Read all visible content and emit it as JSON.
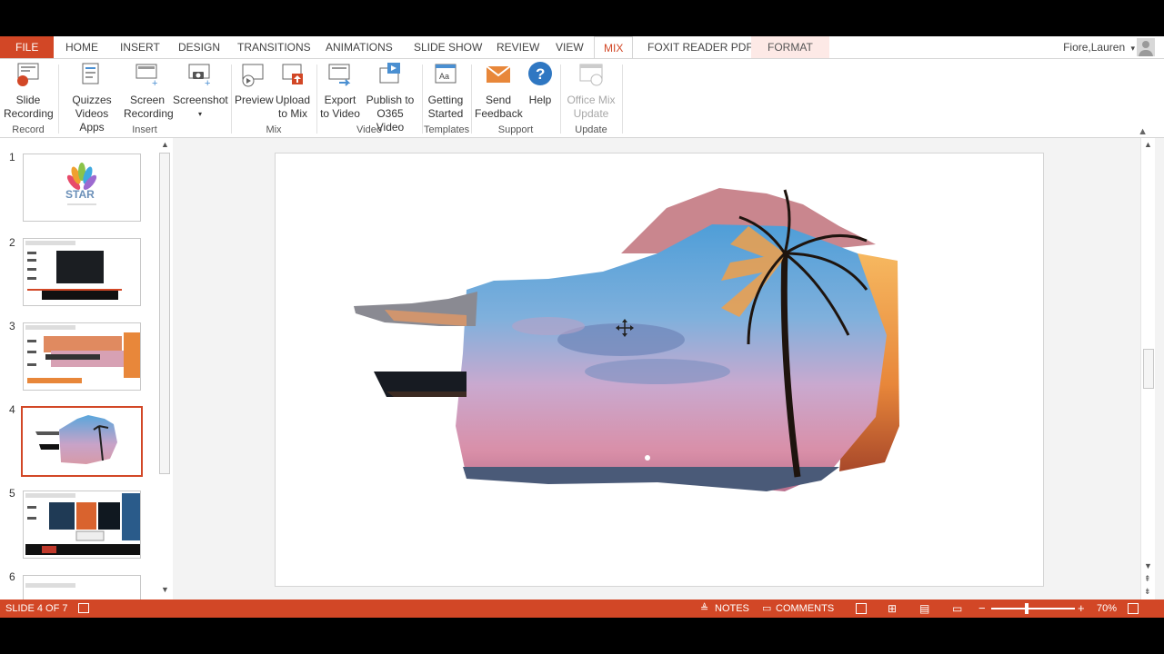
{
  "tabs": {
    "file": "FILE",
    "home": "HOME",
    "insert": "INSERT",
    "design": "DESIGN",
    "transitions": "TRANSITIONS",
    "animations": "ANIMATIONS",
    "slideshow": "SLIDE SHOW",
    "review": "REVIEW",
    "view": "VIEW",
    "mix": "MIX",
    "foxit": "FOXIT READER PDF",
    "format": "FORMAT"
  },
  "user": {
    "name": "Fiore,Lauren",
    "dropdown": "▾"
  },
  "ribbon": {
    "slide_recording": [
      "Slide",
      "Recording"
    ],
    "quizzes": [
      "Quizzes",
      "Videos Apps"
    ],
    "screen_recording": [
      "Screen",
      "Recording"
    ],
    "screenshot": [
      "Screenshot",
      "▾"
    ],
    "preview": [
      "Preview",
      ""
    ],
    "upload": [
      "Upload",
      "to Mix"
    ],
    "export": [
      "Export",
      "to Video"
    ],
    "publish": [
      "Publish to",
      "O365 Video"
    ],
    "getting_started": [
      "Getting",
      "Started"
    ],
    "send_feedback": [
      "Send",
      "Feedback"
    ],
    "help": [
      "Help",
      ""
    ],
    "office_mix_update": [
      "Office Mix",
      "Update"
    ],
    "groups": {
      "record": "Record",
      "insert": "Insert",
      "mix": "Mix",
      "video": "Video",
      "templates": "Templates",
      "support": "Support",
      "update": "Update"
    }
  },
  "slides": [
    {
      "num": "1",
      "logo": "STAR"
    },
    {
      "num": "2"
    },
    {
      "num": "3"
    },
    {
      "num": "4"
    },
    {
      "num": "5"
    },
    {
      "num": "6"
    }
  ],
  "status": {
    "slide": "SLIDE 4 OF 7",
    "notes": "NOTES",
    "comments": "COMMENTS",
    "zoom_minus": "−",
    "zoom_plus": "+",
    "zoom": "70%",
    "zoom_fraction": 0.42
  },
  "colors": {
    "accent": "#d24726",
    "sky_top": "#5aa6dc",
    "sunset_pink": "#d99aa8",
    "sunset_orange": "#e8873a"
  }
}
